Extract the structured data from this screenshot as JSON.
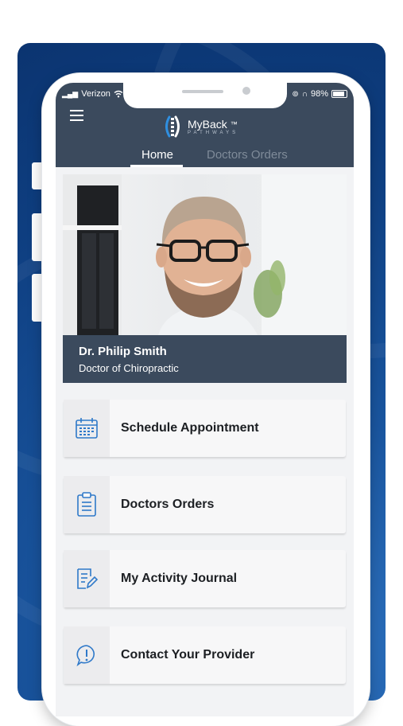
{
  "status_bar": {
    "carrier": "Verizon",
    "battery": "98%"
  },
  "app": {
    "name": "MyBack",
    "trademark": "™",
    "subtitle": "PATHWAYS"
  },
  "tabs": [
    {
      "label": "Home",
      "active": true
    },
    {
      "label": "Doctors Orders",
      "active": false
    }
  ],
  "doctor": {
    "name": "Dr. Philip Smith",
    "title": "Doctor of Chiropractic"
  },
  "menu": [
    {
      "label": "Schedule Appointment",
      "icon": "calendar-icon"
    },
    {
      "label": "Doctors Orders",
      "icon": "clipboard-icon"
    },
    {
      "label": "My Activity Journal",
      "icon": "journal-edit-icon"
    },
    {
      "label": "Contact Your Provider",
      "icon": "chat-alert-icon"
    }
  ],
  "colors": {
    "header": "#3b4a5d",
    "accent_icon": "#2f79c9",
    "background_blue": "#1a56a0"
  }
}
